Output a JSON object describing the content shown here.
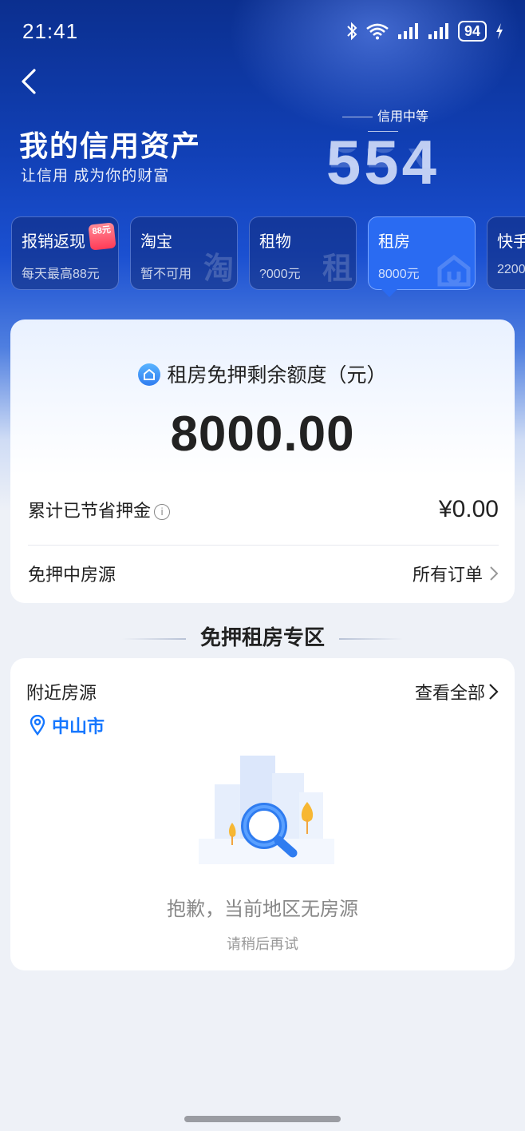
{
  "status_bar": {
    "time": "21:41",
    "battery": "94"
  },
  "header": {
    "title": "我的信用资产",
    "subtitle": "让信用 成为你的财富",
    "credit_level": "信用中等",
    "credit_score": "554"
  },
  "tabs": [
    {
      "title": "报销返现",
      "sub": "每天最高88元",
      "badge": "88元",
      "active": false
    },
    {
      "title": "淘宝",
      "sub": "暂不可用",
      "watermark": "淘",
      "active": false
    },
    {
      "title": "租物",
      "sub": "?000元",
      "watermark": "租",
      "active": false
    },
    {
      "title": "租房",
      "sub": "8000元",
      "active": true
    },
    {
      "title": "快手",
      "sub": "2200",
      "active": false
    }
  ],
  "quota_card": {
    "label": "租房免押剩余额度（元）",
    "value": "8000.00",
    "saved_label": "累计已节省押金",
    "saved_value": "¥0.00",
    "houses_label": "免押中房源",
    "orders_label": "所有订单"
  },
  "section": {
    "title": "免押租房专区"
  },
  "nearby": {
    "title": "附近房源",
    "view_all": "查看全部",
    "city": "中山市",
    "empty_title": "抱歉，当前地区无房源",
    "empty_sub": "请稍后再试"
  },
  "colors": {
    "accent": "#1677ff",
    "hero_dark": "#0b2f8f",
    "tab_active": "#2a6bf2"
  }
}
